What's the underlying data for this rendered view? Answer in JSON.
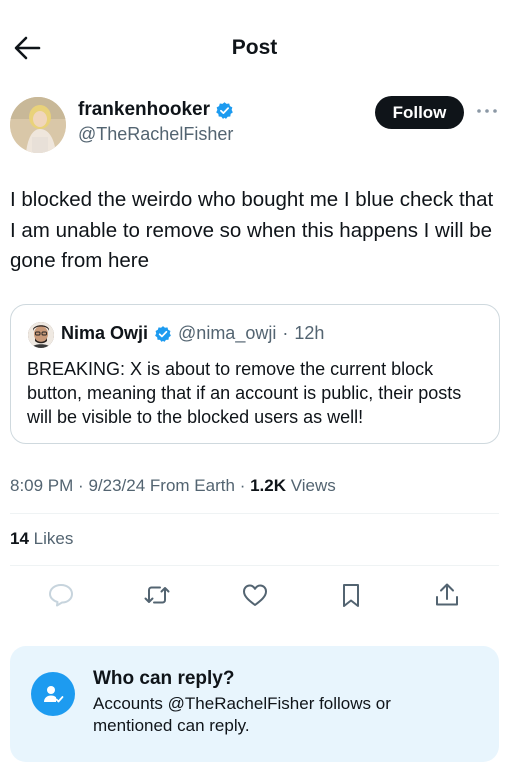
{
  "header": {
    "title": "Post",
    "back_icon": "arrow-left-icon"
  },
  "author": {
    "name": "frankenhooker",
    "handle": "@TheRachelFisher",
    "verified_icon": "verified-badge-icon",
    "follow_label": "Follow",
    "more_icon": "more-horizontal-icon"
  },
  "tweet": {
    "text": "I blocked the weirdo who bought me I blue check that I am unable to remove so when this happens I will be gone from here"
  },
  "quote": {
    "name": "Nima Owji",
    "handle": "@nima_owji",
    "separator": "·",
    "time": "12h",
    "text": "BREAKING: X is about to remove the current block button, meaning that if an account is public, their posts will be visible to the blocked users as well!"
  },
  "meta": {
    "time": "8:09 PM",
    "date": "9/23/24",
    "source": "From Earth",
    "views_count": "1.2K",
    "views_label": "Views",
    "separator": "·"
  },
  "likes": {
    "count": "14",
    "label": "Likes"
  },
  "actions": [
    "reply-icon",
    "repost-icon",
    "like-icon",
    "bookmark-icon",
    "share-icon"
  ],
  "reply_settings": {
    "title": "Who can reply?",
    "text": "Accounts @TheRachelFisher follows or mentioned can reply.",
    "icon": "person-check-icon"
  },
  "colors": {
    "accent": "#1d9bf0",
    "text": "#0f1419",
    "secondary": "#536471",
    "reply_bg": "#e8f5fd"
  }
}
